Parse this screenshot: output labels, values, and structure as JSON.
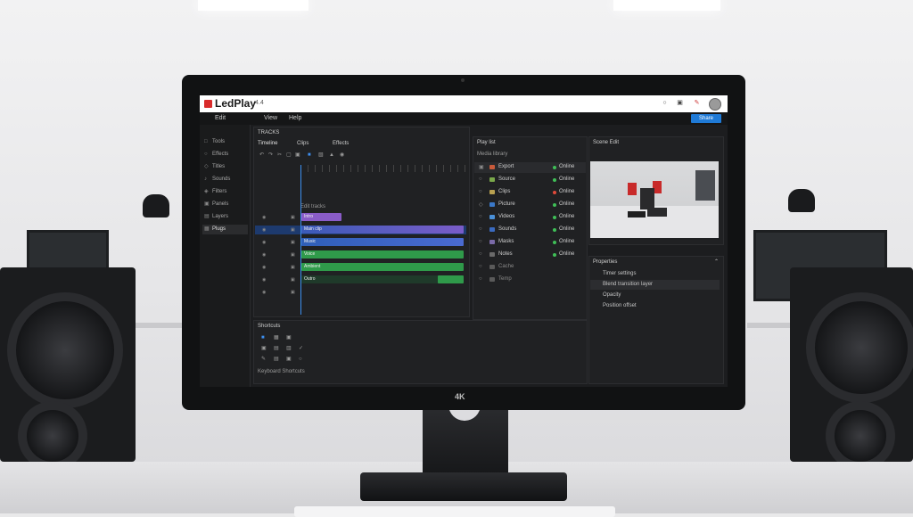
{
  "app": {
    "name": "LedPlay",
    "version": "4.4"
  },
  "titlebar_icons": [
    "circle-icon",
    "lock-icon",
    "pen-icon"
  ],
  "menubar": {
    "items": [
      "Edit",
      "View",
      "Help"
    ],
    "share_label": "Share"
  },
  "sidebar": {
    "items": [
      {
        "label": "Tools",
        "icon": "□"
      },
      {
        "label": "Effects",
        "icon": "○"
      },
      {
        "label": "Titles",
        "icon": "◇"
      },
      {
        "label": "Sounds",
        "icon": "♪"
      },
      {
        "label": "Filters",
        "icon": "◈"
      },
      {
        "label": "Panels",
        "icon": "▣"
      },
      {
        "label": "Layers",
        "icon": "▤"
      },
      {
        "label": "Plugs",
        "icon": "▦"
      }
    ],
    "active_index": 7
  },
  "timeline": {
    "tab_label": "TRACKS",
    "sub_tabs": [
      "Timeline",
      "Clips",
      "Effects"
    ],
    "section_label": "Edit tracks",
    "clips": [
      {
        "label": "Intro",
        "color": "#8a5cc8"
      },
      {
        "label": "Main clip",
        "color": "#3b5bb8"
      },
      {
        "label": "Music",
        "color": "#2f9a4a"
      },
      {
        "label": "Voice",
        "color": "#2f9a4a"
      },
      {
        "label": "Ambient",
        "color": "#2f9a4a"
      },
      {
        "label": "Outro",
        "color": "#1f3a2a"
      }
    ]
  },
  "media": {
    "title": "Play list",
    "subtitle": "Media library",
    "items": [
      {
        "name": "Export",
        "status": "Online",
        "swatch": "#c85a3a",
        "status_color": "#3fbf57"
      },
      {
        "name": "Source",
        "status": "Online",
        "swatch": "#7aa84a",
        "status_color": "#3fbf57"
      },
      {
        "name": "Clips",
        "status": "Online",
        "swatch": "#b8a050",
        "status_color": "#e04a3a"
      },
      {
        "name": "Picture",
        "status": "Online",
        "swatch": "#3a78c8",
        "status_color": "#3fbf57"
      },
      {
        "name": "Videos",
        "status": "Online",
        "swatch": "#4a90d8",
        "status_color": "#3fbf57"
      },
      {
        "name": "Sounds",
        "status": "Online",
        "swatch": "#3a6ac0",
        "status_color": "#3fbf57"
      },
      {
        "name": "Masks",
        "status": "Online",
        "swatch": "#7a6aa8",
        "status_color": "#3fbf57"
      },
      {
        "name": "Notes",
        "status": "Online",
        "swatch": "#6a6a6a",
        "status_color": "#3fbf57"
      },
      {
        "name": "Cache",
        "status": "",
        "swatch": "#5a5a5a",
        "status_color": ""
      },
      {
        "name": "Temp",
        "status": "",
        "swatch": "#5a5a5a",
        "status_color": ""
      }
    ]
  },
  "preview": {
    "title": "Scene Edit"
  },
  "properties": {
    "title": "Properties",
    "rows": [
      "Timer settings",
      "Blend transition layer",
      "Opacity",
      "Position offset"
    ],
    "highlight_index": 1
  },
  "tools_panel": {
    "title": "Shortcuts",
    "footer": "Keyboard Shortcuts"
  },
  "monitor_badge": "4K"
}
